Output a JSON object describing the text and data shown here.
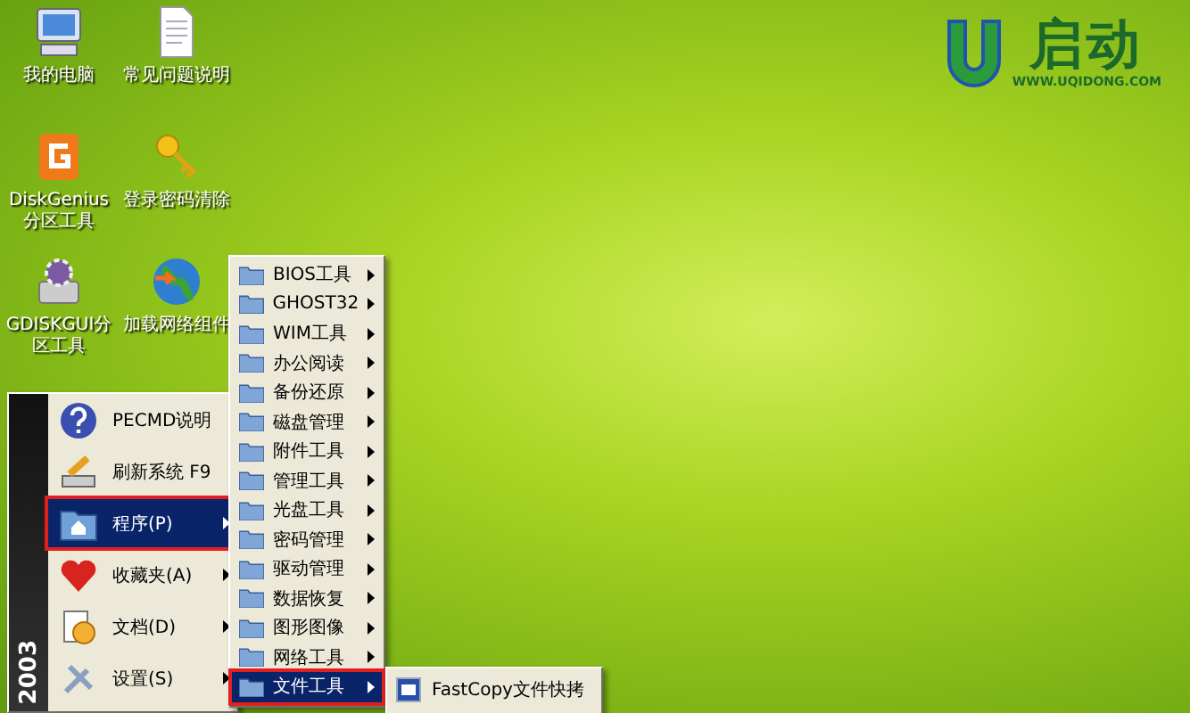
{
  "desktop_icons": [
    {
      "kind": "computer",
      "label": "我的电脑"
    },
    {
      "kind": "document",
      "label": "常见问题说明"
    },
    {
      "kind": "disk",
      "label": "DiskGenius分区工具"
    },
    {
      "kind": "key",
      "label": "登录密码清除"
    },
    {
      "kind": "gear",
      "label": "GDISKGUI分区工具"
    },
    {
      "kind": "globe",
      "label": "加载网络组件"
    }
  ],
  "logo": {
    "name": "启动",
    "url": "WWW.UQIDONG.COM"
  },
  "start_menu": {
    "edition": "2003",
    "items": [
      {
        "kind": "help",
        "label": "PECMD说明",
        "submenu": false,
        "selected": false
      },
      {
        "kind": "refresh",
        "label": "刷新系统 F9",
        "submenu": false,
        "selected": false
      },
      {
        "kind": "programs",
        "label": "程序(P)",
        "submenu": true,
        "selected": true
      },
      {
        "kind": "favorites",
        "label": "收藏夹(A)",
        "submenu": true,
        "selected": false
      },
      {
        "kind": "documents",
        "label": "文档(D)",
        "submenu": true,
        "selected": false
      },
      {
        "kind": "settings",
        "label": "设置(S)",
        "submenu": true,
        "selected": false
      }
    ]
  },
  "programs_menu": {
    "items": [
      {
        "label": "BIOS工具",
        "selected": false
      },
      {
        "label": "GHOST32",
        "selected": false
      },
      {
        "label": "WIM工具",
        "selected": false
      },
      {
        "label": "办公阅读",
        "selected": false
      },
      {
        "label": "备份还原",
        "selected": false
      },
      {
        "label": "磁盘管理",
        "selected": false
      },
      {
        "label": "附件工具",
        "selected": false
      },
      {
        "label": "管理工具",
        "selected": false
      },
      {
        "label": "光盘工具",
        "selected": false
      },
      {
        "label": "密码管理",
        "selected": false
      },
      {
        "label": "驱动管理",
        "selected": false
      },
      {
        "label": "数据恢复",
        "selected": false
      },
      {
        "label": "图形图像",
        "selected": false
      },
      {
        "label": "网络工具",
        "selected": false
      },
      {
        "label": "文件工具",
        "selected": true
      }
    ]
  },
  "file_tools_menu": {
    "items": [
      {
        "label": "FastCopy文件快拷"
      }
    ]
  }
}
